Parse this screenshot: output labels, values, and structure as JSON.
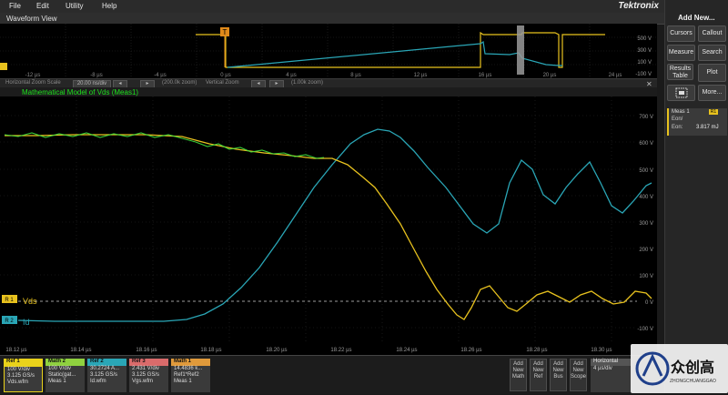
{
  "menu": {
    "file": "File",
    "edit": "Edit",
    "utility": "Utility",
    "help": "Help",
    "brand": "Tektronix"
  },
  "waveform_view": {
    "title": "Waveform View"
  },
  "overview": {
    "x_ticks": [
      "-12 µs",
      "-8 µs",
      "-4 µs",
      "0 µs",
      "4 µs",
      "8 µs",
      "12 µs",
      "16 µs",
      "20 µs",
      "24 µs"
    ],
    "y_ticks": [
      "500 V",
      "300 V",
      "100 V",
      "-100 V"
    ],
    "trigger_marker": "T"
  },
  "zoom": {
    "hscale_label": "Horizontal Zoom Scale",
    "hscale_value": "20.00 ns/div",
    "hscale_note": "(200.0k zoom)",
    "vzoom_label": "Vertical Zoom",
    "vzoom_note": "(1.00k zoom)",
    "panel_title": "Mathematical Model of Vds (Meas1)"
  },
  "plot": {
    "y_ticks": [
      "700 V",
      "600 V",
      "500 V",
      "400 V",
      "300 V",
      "200 V",
      "100 V",
      "0 V",
      "-100 V"
    ],
    "x_ticks": [
      "18.12 µs",
      "18.14 µs",
      "18.16 µs",
      "18.18 µs",
      "18.20 µs",
      "18.22 µs",
      "18.24 µs",
      "18.26 µs",
      "18.28 µs",
      "18.30 µs"
    ],
    "ref1_marker": "R 1",
    "ref1_label": "Vds",
    "ref2_marker": "R 2",
    "ref2_label": "Id",
    "colors": {
      "vds": "#e8c21e",
      "id": "#2aa6b6",
      "math": "#3de03d"
    }
  },
  "badges": [
    {
      "title": "Ref 1",
      "l1": "100 V/div",
      "l2": "3.125 GS/s",
      "l3": "Vds.wfm",
      "color": "#e9d21a"
    },
    {
      "title": "Math 2",
      "l1": "100 V/div",
      "l2": "Static(gat...",
      "l3": "Meas 1",
      "color": "#8fd13f"
    },
    {
      "title": "Ref 2",
      "l1": "30.2724 A...",
      "l2": "3.125 GS/s",
      "l3": "Id.wfm",
      "color": "#2aa6b6"
    },
    {
      "title": "Ref 3",
      "l1": "2.431 V/div",
      "l2": "3.125 GS/s",
      "l3": "Vgs.wfm",
      "color": "#d96b6b"
    },
    {
      "title": "Math 1",
      "l1": "14.4836 k...",
      "l2": "Ref1*Ref2",
      "l3": "Meas 1",
      "color": "#e09a3b"
    }
  ],
  "add_buttons": [
    {
      "l1": "Add",
      "l2": "New",
      "l3": "Math"
    },
    {
      "l1": "Add",
      "l2": "New",
      "l3": "Ref"
    },
    {
      "l1": "Add",
      "l2": "New",
      "l3": "Bus"
    },
    {
      "l1": "Add",
      "l2": "New",
      "l3": "Scope"
    }
  ],
  "horizontal": {
    "title": "Horizontal",
    "value": "4 µs/div"
  },
  "right_panel": {
    "title": "Add New...",
    "cursors": "Cursors",
    "callout": "Callout",
    "measure": "Measure",
    "search": "Search",
    "results_table_1": "Results",
    "results_table_2": "Table",
    "plot": "Plot",
    "more": "More...",
    "meas_title": "Meas 1",
    "meas_badge": "R1",
    "meas_name_1": "Eon/",
    "meas_name_2": "Eon:",
    "meas_value": "3.817 mJ"
  },
  "watermark": {
    "main": "众创高",
    "sub": "ZHONGCHUANGGAO"
  }
}
